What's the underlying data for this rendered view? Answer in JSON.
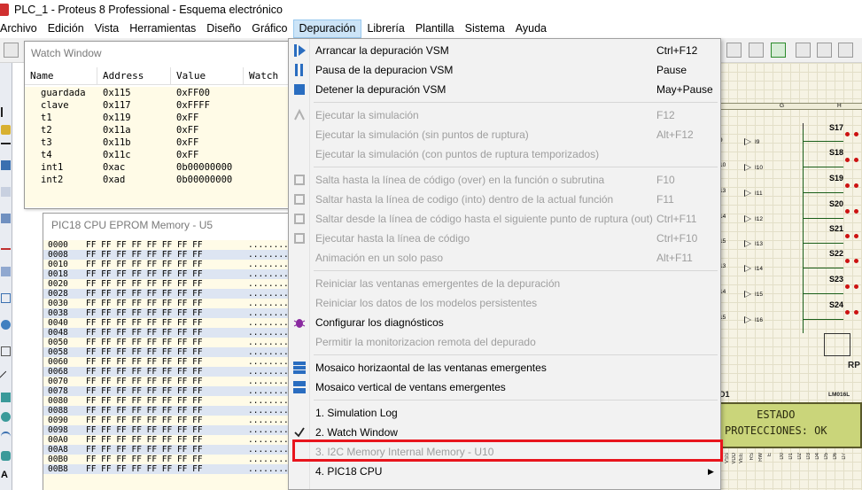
{
  "window": {
    "title": "PLC_1 - Proteus 8 Professional - Esquema electrónico"
  },
  "menubar": {
    "items": [
      "Archivo",
      "Edición",
      "Vista",
      "Herramientas",
      "Diseño",
      "Gráfico",
      "Depuración",
      "Librería",
      "Plantilla",
      "Sistema",
      "Ayuda"
    ],
    "active": "Depuración"
  },
  "watch_window": {
    "title": "Watch Window",
    "columns": [
      "Name",
      "Address",
      "Value",
      "Watch"
    ],
    "rows": [
      {
        "name": "guardada",
        "address": "0x115",
        "value": "0xFF00"
      },
      {
        "name": "clave",
        "address": "0x117",
        "value": "0xFFFF"
      },
      {
        "name": "t1",
        "address": "0x119",
        "value": "0xFF"
      },
      {
        "name": "t2",
        "address": "0x11a",
        "value": "0xFF"
      },
      {
        "name": "t3",
        "address": "0x11b",
        "value": "0xFF"
      },
      {
        "name": "t4",
        "address": "0x11c",
        "value": "0xFF"
      },
      {
        "name": "int1",
        "address": "0xac",
        "value": "0b00000000"
      },
      {
        "name": "int2",
        "address": "0xad",
        "value": "0b00000000"
      }
    ]
  },
  "eprom_window": {
    "title": "PIC18 CPU EPROM Memory - U5",
    "bytes_row": "FF FF FF FF FF FF FF FF",
    "ascii_row": "........",
    "addresses": [
      "0000",
      "0008",
      "0010",
      "0018",
      "0020",
      "0028",
      "0030",
      "0038",
      "0040",
      "0048",
      "0050",
      "0058",
      "0060",
      "0068",
      "0070",
      "0078",
      "0080",
      "0088",
      "0090",
      "0098",
      "00A0",
      "00A8",
      "00B0",
      "00B8"
    ]
  },
  "depuracion_menu": {
    "items": [
      {
        "label": "Arrancar la depuración VSM",
        "shortcut": "Ctrl+F12",
        "disabled": false,
        "icon": "start-debug-icon"
      },
      {
        "label": "Pausa de la depuracion VSM",
        "shortcut": "Pause",
        "disabled": false,
        "icon": "pause-icon"
      },
      {
        "label": "Detener la depuración VSM",
        "shortcut": "May+Pause",
        "disabled": false,
        "icon": "stop-icon"
      },
      {
        "label": "Ejecutar la simulación",
        "shortcut": "F12",
        "disabled": true,
        "icon": "run-icon"
      },
      {
        "label": "Ejecutar la simulación (sin puntos de ruptura)",
        "shortcut": "Alt+F12",
        "disabled": true,
        "icon": ""
      },
      {
        "label": "Ejecutar la simulación (con puntos de ruptura temporizados)",
        "shortcut": "",
        "disabled": true,
        "icon": ""
      },
      {
        "label": "Salta hasta la  línea de código (over) en la función o subrutina",
        "shortcut": "F10",
        "disabled": true,
        "icon": "step-over-icon"
      },
      {
        "label": "Saltar hasta la línea de codigo (into) dentro de la actual función",
        "shortcut": "F11",
        "disabled": true,
        "icon": "step-into-icon"
      },
      {
        "label": "Saltar desde la línea de código hasta el siguiente punto de ruptura (out)",
        "shortcut": "Ctrl+F11",
        "disabled": true,
        "icon": "step-out-icon"
      },
      {
        "label": "Ejecutar hasta la línea de código",
        "shortcut": "Ctrl+F10",
        "disabled": true,
        "icon": "run-to-cursor-icon"
      },
      {
        "label": "Animación en un solo paso",
        "shortcut": "Alt+F11",
        "disabled": true,
        "icon": ""
      },
      {
        "label": "Reiniciar las ventanas emergentes de la depuración",
        "shortcut": "",
        "disabled": true,
        "icon": ""
      },
      {
        "label": "Reiniciar los datos de los modelos persistentes",
        "shortcut": "",
        "disabled": true,
        "icon": ""
      },
      {
        "label": "Configurar los diagnósticos",
        "shortcut": "",
        "disabled": false,
        "icon": "bug-icon"
      },
      {
        "label": "Permitir la monitorizacion remota del depurado",
        "shortcut": "",
        "disabled": true,
        "icon": ""
      },
      {
        "label": "Mosaico horizaontal de las ventanas emergentes",
        "shortcut": "",
        "disabled": false,
        "icon": "tile-horizontal-icon"
      },
      {
        "label": "Mosaico vertical de ventans emergentes",
        "shortcut": "",
        "disabled": false,
        "icon": "tile-vertical-icon"
      },
      {
        "label": "1. Simulation Log",
        "shortcut": "",
        "disabled": false,
        "icon": ""
      },
      {
        "label": "2. Watch Window",
        "shortcut": "",
        "disabled": false,
        "icon": "checkmark-icon"
      },
      {
        "label": "3. I2C Memory Internal Memory - U10",
        "shortcut": "",
        "disabled": true,
        "icon": ""
      },
      {
        "label": "4. PIC18 CPU",
        "shortcut": "",
        "disabled": false,
        "icon": "",
        "submenu": true
      }
    ]
  },
  "schematic": {
    "switches": [
      "S17",
      "S18",
      "S19",
      "S20",
      "S21",
      "S22",
      "S23",
      "S24"
    ],
    "inputs": [
      "I9",
      "I10",
      "I11",
      "I12",
      "I13",
      "I14",
      "I15",
      "I16"
    ],
    "pins": [
      "9",
      "10",
      "13",
      "14",
      "15",
      "13",
      "14",
      "15"
    ],
    "ruler_letters": [
      "G",
      "H"
    ],
    "rp_label": "RP",
    "lcd_ref": "D1",
    "lcd_model": "LM016L",
    "lcd_line1": "     ESTADO",
    "lcd_line2": "PROTECCIONES: OK",
    "lcd_pins": [
      "VSS",
      "VDD",
      "VEE",
      "RS",
      "RW",
      "E",
      "D0",
      "D1",
      "D2",
      "D3",
      "D4",
      "D5",
      "D6",
      "D7"
    ]
  }
}
